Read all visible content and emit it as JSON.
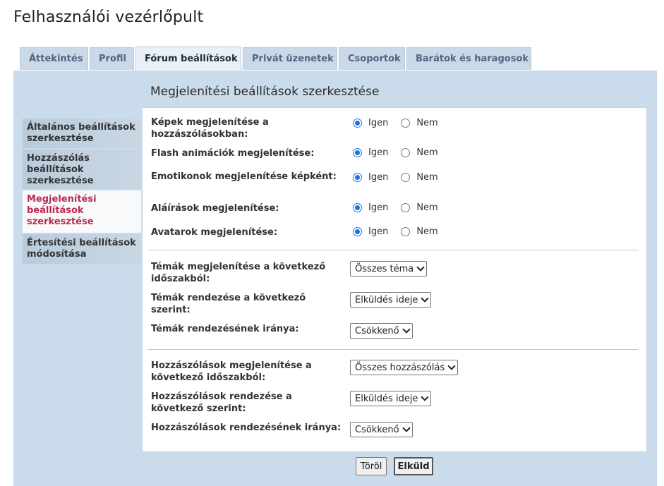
{
  "page": {
    "title": "Felhasználói vezérlőpult"
  },
  "tabs": [
    {
      "label": "Áttekintés"
    },
    {
      "label": "Profil"
    },
    {
      "label": "Fórum beállítások"
    },
    {
      "label": "Privát üzenetek"
    },
    {
      "label": "Csoportok"
    },
    {
      "label": "Barátok és haragosok"
    }
  ],
  "active_tab": "Fórum beállítások",
  "heading": "Megjelenítési beállítások szerkesztése",
  "sidemenu": [
    {
      "label": "Általános beállítások szerkesztése"
    },
    {
      "label": "Hozzászólás beállítások szerkesztése"
    },
    {
      "label": "Megjelenítési beállítások szerkesztése"
    },
    {
      "label": "Értesítési beállítások módosítása"
    }
  ],
  "radio_options": {
    "yes": "Igen",
    "no": "Nem"
  },
  "settings": [
    {
      "label": "Képek megjelenítése a hozzászólásokban:",
      "value": "Igen"
    },
    {
      "label": "Flash animációk megjelenítése:",
      "value": "Igen"
    },
    {
      "label": "Emotikonok megjelenítése képként:",
      "value": "Igen"
    },
    {
      "label": "Aláírások megjelenítése:",
      "value": "Igen"
    },
    {
      "label": "Avatarok megjelenítése:",
      "value": "Igen"
    }
  ],
  "topics": [
    {
      "label": "Témák megjelenítése a következő időszakból:",
      "value": "Összes téma"
    },
    {
      "label": "Témák rendezése a következő szerint:",
      "value": "Elküldés ideje"
    },
    {
      "label": "Témák rendezésének iránya:",
      "value": "Csökkenő"
    }
  ],
  "posts": [
    {
      "label": "Hozzászólások megjelenítése a következő időszakból:",
      "value": "Összes hozzászólás"
    },
    {
      "label": "Hozzászólások rendezése a következő szerint:",
      "value": "Elküldés ideje"
    },
    {
      "label": "Hozzászólások rendezésének iránya:",
      "value": "Csökkenő"
    }
  ],
  "buttons": {
    "reset": "Töröl",
    "submit": "Elküld"
  },
  "colors": {
    "active_menu": "#bc2a4d",
    "panel_bg": "#cadceb",
    "radio_checked": "#1a73e8"
  }
}
